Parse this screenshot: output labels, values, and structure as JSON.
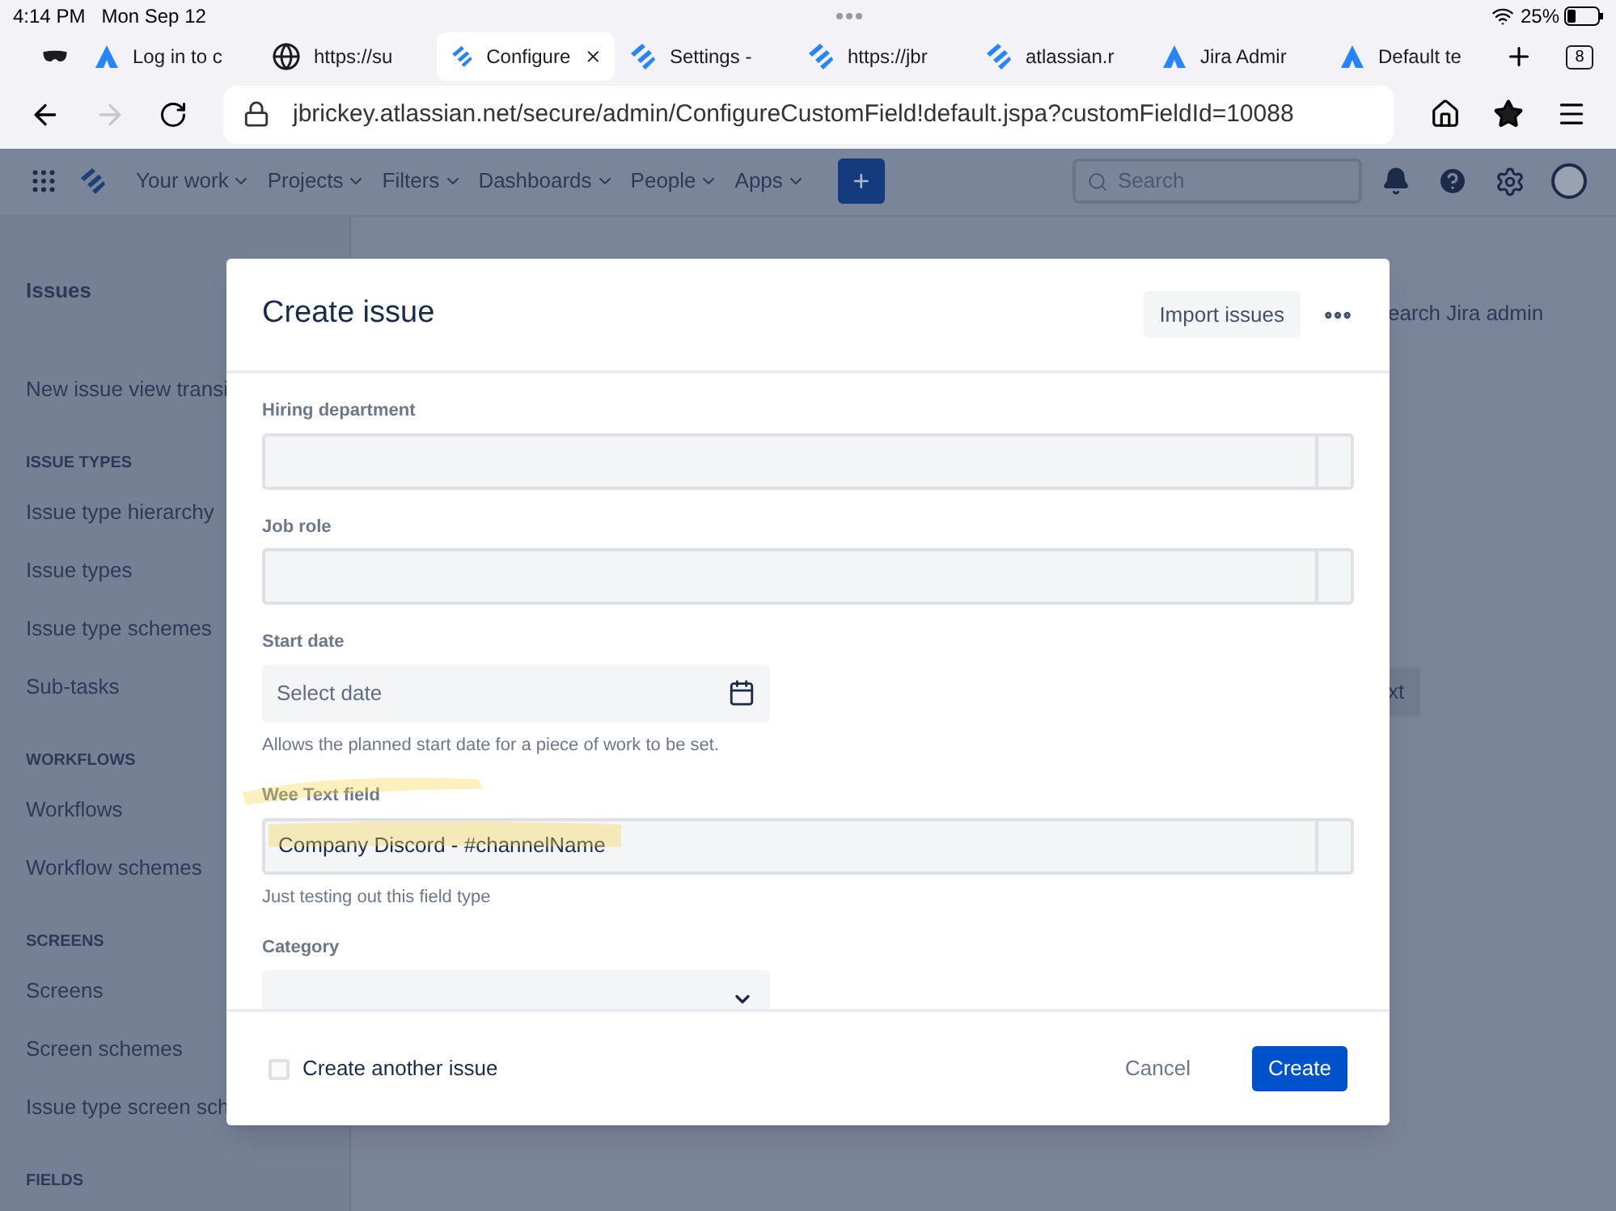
{
  "status_bar": {
    "time": "4:14 PM",
    "date": "Mon Sep 12",
    "battery": "25%"
  },
  "browser_tabs": [
    {
      "kind": "private",
      "selected": false
    },
    {
      "kind": "atlassian",
      "label": "Log in to c",
      "selected": false
    },
    {
      "kind": "globe",
      "label": "https://su",
      "selected": false
    },
    {
      "kind": "jira",
      "label": "Configure",
      "selected": true
    },
    {
      "kind": "jira",
      "label": "Settings -",
      "selected": false
    },
    {
      "kind": "jira",
      "label": "https://jbr",
      "selected": false
    },
    {
      "kind": "jira",
      "label": "atlassian.r",
      "selected": false
    },
    {
      "kind": "atlassian",
      "label": "Jira Admir",
      "selected": false
    },
    {
      "kind": "atlassian",
      "label": "Default te",
      "selected": false
    }
  ],
  "tab_count": "8",
  "address_bar": {
    "url": "jbrickey.atlassian.net/secure/admin/ConfigureCustomField!default.jspa?customFieldId=10088"
  },
  "nav": {
    "items": [
      "Your work",
      "Projects",
      "Filters",
      "Dashboards",
      "People",
      "Apps"
    ],
    "create": "+",
    "search": {
      "placeholder": "Search"
    }
  },
  "sidebar": {
    "title": "Issues",
    "items": [
      {
        "kind": "link",
        "label": "New issue view transi"
      },
      {
        "kind": "heading",
        "label": "ISSUE TYPES"
      },
      {
        "kind": "link",
        "label": "Issue type hierarchy"
      },
      {
        "kind": "link",
        "label": "Issue types"
      },
      {
        "kind": "link",
        "label": "Issue type schemes"
      },
      {
        "kind": "link",
        "label": "Sub-tasks"
      },
      {
        "kind": "heading",
        "label": "WORKFLOWS"
      },
      {
        "kind": "link",
        "label": "Workflows"
      },
      {
        "kind": "link",
        "label": "Workflow schemes"
      },
      {
        "kind": "heading",
        "label": "SCREENS"
      },
      {
        "kind": "link",
        "label": "Screens"
      },
      {
        "kind": "link",
        "label": "Screen schemes"
      },
      {
        "kind": "link",
        "label": "Issue type screen sch"
      },
      {
        "kind": "heading",
        "label": "FIELDS"
      }
    ]
  },
  "background": {
    "search_text": "earch Jira admin",
    "button_text": "xt"
  },
  "dialog": {
    "title": "Create issue",
    "import_button": "Import issues",
    "fields": [
      {
        "kind": "text",
        "label": "Hiring department",
        "highlighted": false
      },
      {
        "kind": "text",
        "label": "Job role",
        "highlighted": false
      },
      {
        "kind": "date",
        "label": "Start date",
        "placeholder": "Select date",
        "help": "Allows the planned start date for a piece of work to be set.",
        "highlighted": false
      },
      {
        "kind": "text",
        "label": "Wee Text field",
        "value": "Company Discord - #channelName",
        "help": "Just testing out this field type",
        "highlighted": true
      },
      {
        "kind": "select",
        "label": "Category",
        "highlighted": false
      }
    ],
    "create_another": {
      "label": "Create another issue",
      "checked": false
    },
    "cancel": "Cancel",
    "create": "Create"
  }
}
